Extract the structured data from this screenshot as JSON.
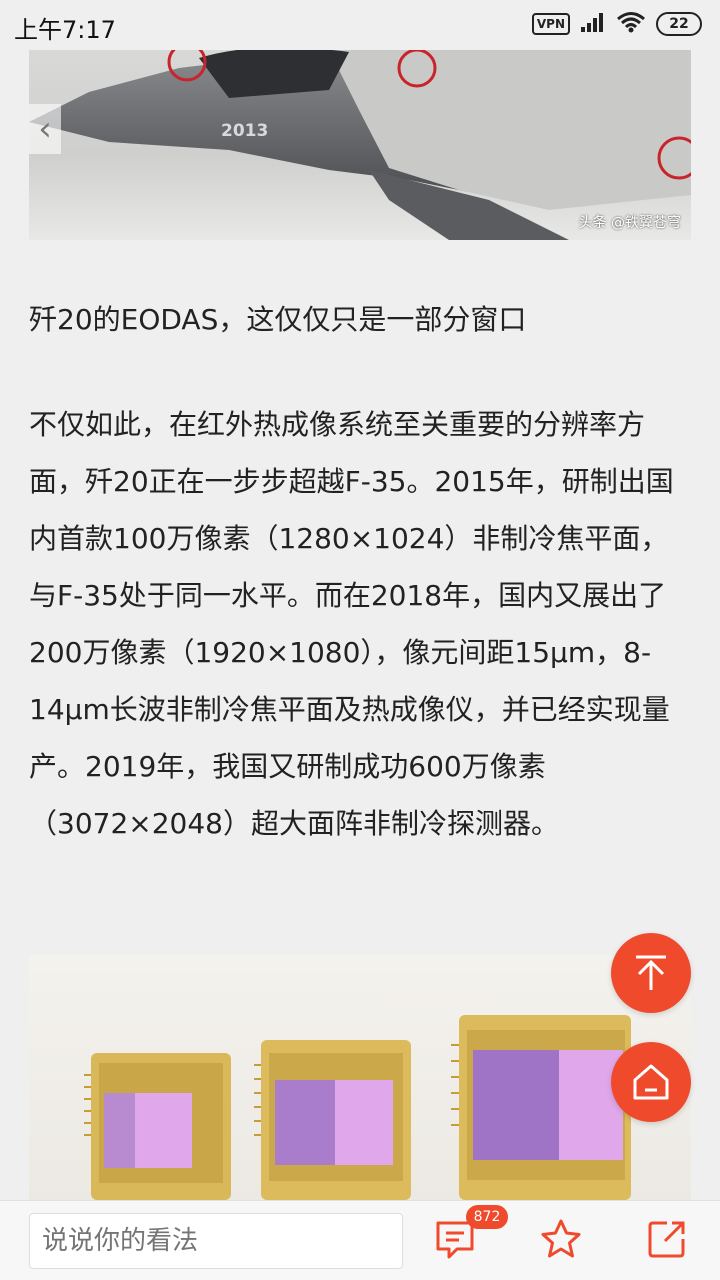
{
  "status_bar": {
    "time": "上午7:17",
    "vpn": "VPN",
    "battery": "22"
  },
  "article": {
    "image1_caption": "头条 @铁翼苍穹",
    "image1_text": "2013",
    "heading": "歼20的EODAS，这仅仅只是一部分窗口",
    "paragraph": "不仅如此，在红外热成像系统至关重要的分辨率方面，歼20正在一步步超越F-35。2015年，研制出国内首款100万像素（1280×1024）非制冷焦平面，与F-35处于同一水平。而在2018年，国内又展出了200万像素（1920×1080），像元间距15μm，8-14μm长波非制冷焦平面及热成像仪，并已经实现量产。2019年，我国又研制成功600万像素（3072×2048）超大面阵非制冷探测器。"
  },
  "bottom_bar": {
    "comment_placeholder": "说说你的看法",
    "comment_count": "872"
  },
  "colors": {
    "accent": "#f04a2c",
    "background": "#efefef"
  },
  "icons": [
    "signal-icon",
    "wifi-icon",
    "chevron-left-icon",
    "arrow-up-icon",
    "home-icon",
    "comment-icon",
    "star-icon",
    "share-icon"
  ]
}
